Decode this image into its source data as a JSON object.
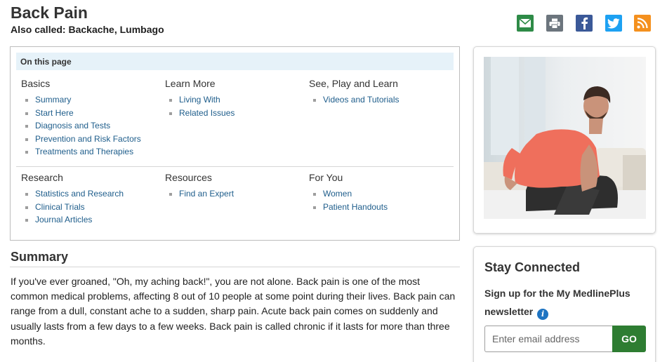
{
  "header": {
    "title": "Back Pain",
    "also_called": "Also called: Backache, Lumbago"
  },
  "share_icons": [
    "email-icon",
    "print-icon",
    "facebook-icon",
    "twitter-icon",
    "rss-icon"
  ],
  "toc": {
    "heading": "On this page",
    "sections": [
      {
        "title": "Basics",
        "links": [
          "Summary",
          "Start Here",
          "Diagnosis and Tests",
          "Prevention and Risk Factors",
          "Treatments and Therapies"
        ]
      },
      {
        "title": "Learn More",
        "links": [
          "Living With",
          "Related Issues"
        ]
      },
      {
        "title": "See, Play and Learn",
        "links": [
          "Videos and Tutorials"
        ]
      },
      {
        "title": "Research",
        "links": [
          "Statistics and Research",
          "Clinical Trials",
          "Journal Articles"
        ]
      },
      {
        "title": "Resources",
        "links": [
          "Find an Expert"
        ]
      },
      {
        "title": "For You",
        "links": [
          "Women",
          "Patient Handouts"
        ]
      }
    ]
  },
  "summary": {
    "heading": "Summary",
    "text": "If you've ever groaned, \"Oh, my aching back!\", you are not alone. Back pain is one of the most common medical problems, affecting 8 out of 10 people at some point during their lives. Back pain can range from a dull, constant ache to a sudden, sharp pain. Acute back pain comes on suddenly and usually lasts from a few days to a few weeks. Back pain is called chronic if it lasts for more than three months."
  },
  "stay_connected": {
    "heading": "Stay Connected",
    "subheading": "Sign up for the My MedlinePlus newsletter",
    "email_placeholder": "Enter email address",
    "go_label": "GO"
  },
  "colors": {
    "link": "#1e5d8b",
    "toc_header_bg": "#e6f2f9",
    "go_button": "#2e7d32",
    "email_icon": "#2e8b47",
    "print_icon": "#6c757d",
    "facebook_icon": "#3b5998",
    "twitter_icon": "#1da1f2",
    "rss_icon": "#f4901e"
  }
}
